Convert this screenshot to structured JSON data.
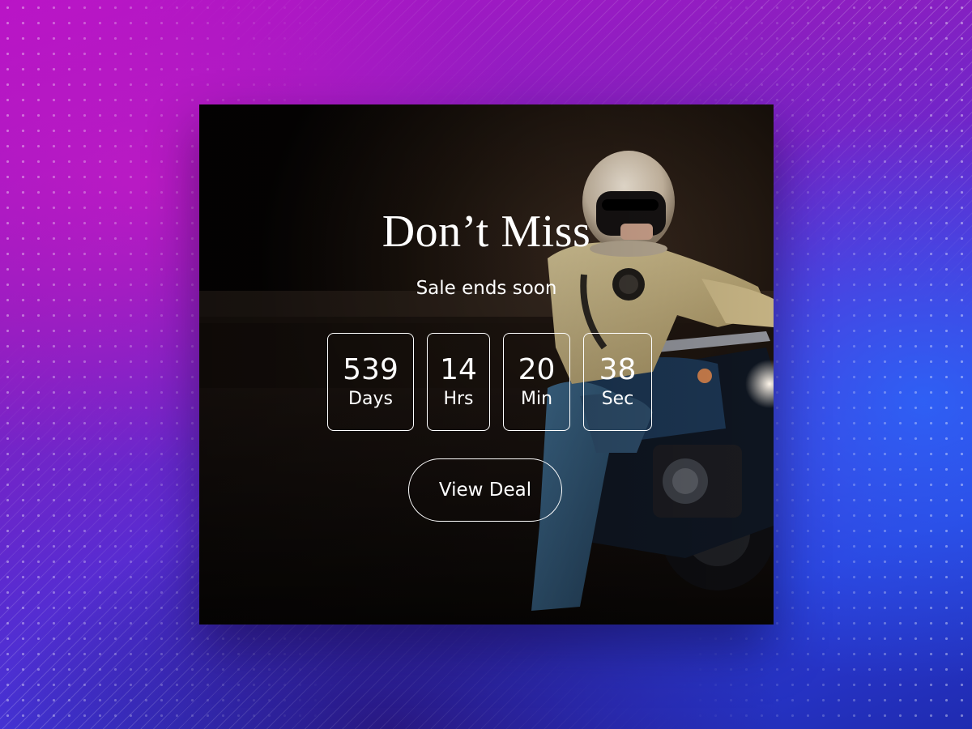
{
  "promo": {
    "title": "Don’t Miss",
    "subtitle": "Sale ends soon",
    "countdown": [
      {
        "value": "539",
        "unit": "Days"
      },
      {
        "value": "14",
        "unit": "Hrs"
      },
      {
        "value": "20",
        "unit": "Min"
      },
      {
        "value": "38",
        "unit": "Sec"
      }
    ],
    "cta_label": "View Deal"
  },
  "colors": {
    "text": "#ffffff",
    "border": "#ffffff",
    "card_background": "#0a0706",
    "background_magenta": "#b514c6",
    "background_blue": "#2d3bd8"
  },
  "image": {
    "subject": "rider-in-space-helmet-on-motorcycle"
  }
}
